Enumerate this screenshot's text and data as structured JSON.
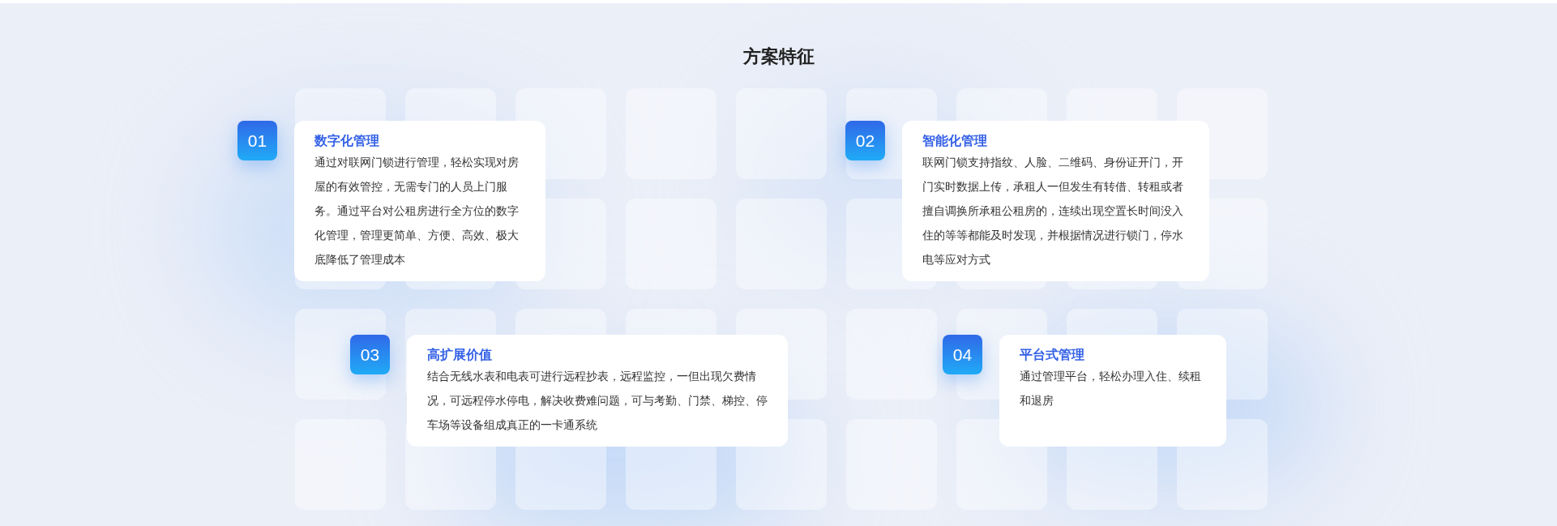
{
  "section_title": "方案特征",
  "features": [
    {
      "number": "01",
      "title": "数字化管理",
      "description": "通过对联网门锁进行管理，轻松实现对房屋的有效管控，无需专门的人员上门服务。通过平台对公租房进行全方位的数字化管理，管理更简单、方便、高效、极大底降低了管理成本"
    },
    {
      "number": "02",
      "title": "智能化管理",
      "description": "联网门锁支持指纹、人脸、二维码、身份证开门，开门实时数据上传，承租人一但发生有转借、转租或者擅自调换所承租公租房的，连续出现空置长时间没入住的等等都能及时发现，并根据情况进行锁门，停水电等应对方式"
    },
    {
      "number": "03",
      "title": "高扩展价值",
      "description": "结合无线水表和电表可进行远程抄表，远程监控，一但出现欠费情况，可远程停水停电，解决收费难问题，可与考勤、门禁、梯控、停车场等设备组成真正的一卡通系统"
    },
    {
      "number": "04",
      "title": "平台式管理",
      "description": "通过管理平台，轻松办理入住、续租和退房"
    }
  ]
}
